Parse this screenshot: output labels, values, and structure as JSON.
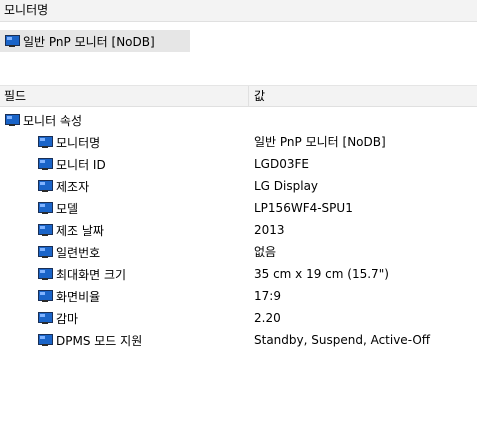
{
  "header": {
    "title": "모니터명"
  },
  "device": {
    "name": "일반 PnP 모니터 [NoDB]",
    "icon": "monitor-icon"
  },
  "columns": {
    "field": "필드",
    "value": "값"
  },
  "group": {
    "label": "모니터 속성",
    "icon": "monitor-icon"
  },
  "properties": [
    {
      "key": "모니터명",
      "value": "일반 PnP 모니터 [NoDB]"
    },
    {
      "key": "모니터 ID",
      "value": "LGD03FE"
    },
    {
      "key": "제조자",
      "value": "LG Display"
    },
    {
      "key": "모델",
      "value": "LP156WF4-SPU1"
    },
    {
      "key": "제조 날짜",
      "value": "2013"
    },
    {
      "key": "일련번호",
      "value": "없음"
    },
    {
      "key": "최대화면 크기",
      "value": "35 cm x 19 cm (15.7\")"
    },
    {
      "key": "화면비율",
      "value": "17:9"
    },
    {
      "key": "감마",
      "value": "2.20"
    },
    {
      "key": "DPMS 모드 지원",
      "value": "Standby, Suspend, Active-Off"
    }
  ]
}
